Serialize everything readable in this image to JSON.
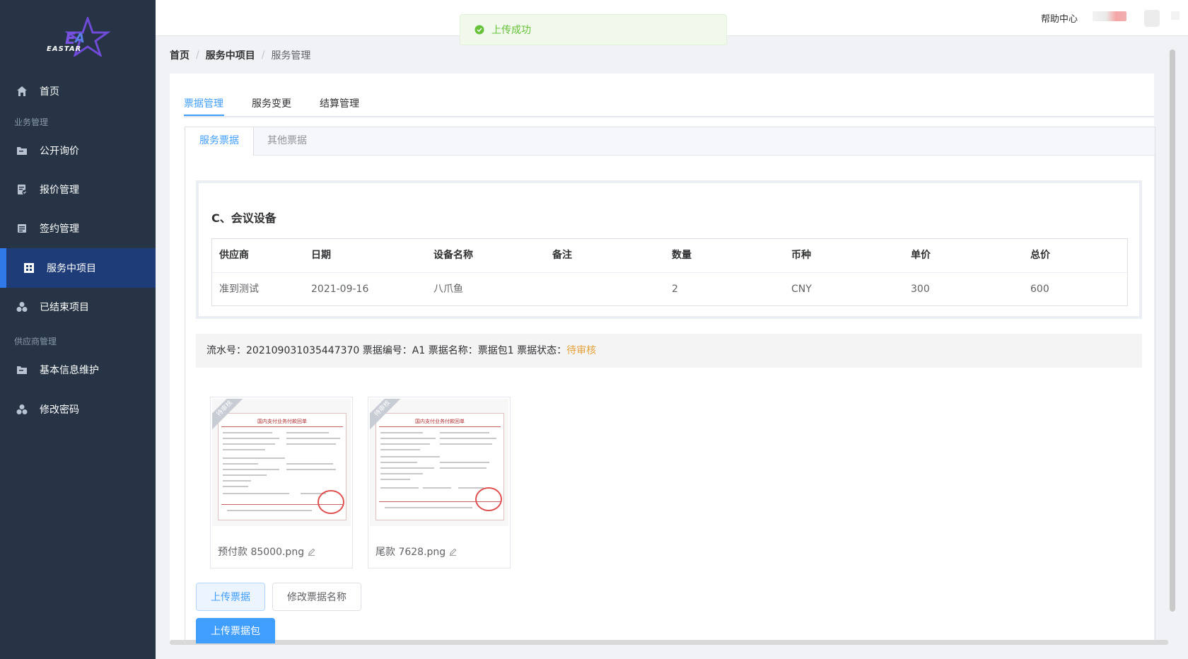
{
  "brand": {
    "logo_text": "EASTAR"
  },
  "sidebar": {
    "items": [
      {
        "label": "首页",
        "icon": "home-icon"
      },
      {
        "label": "公开询价",
        "icon": "folder-icon"
      },
      {
        "label": "报价管理",
        "icon": "doc-check-icon"
      },
      {
        "label": "签约管理",
        "icon": "contract-icon"
      },
      {
        "label": "服务中项目",
        "icon": "grid-icon"
      },
      {
        "label": "已结束项目",
        "icon": "cluster-icon"
      },
      {
        "label": "基本信息维护",
        "icon": "folder-icon"
      },
      {
        "label": "修改密码",
        "icon": "cluster-icon"
      }
    ],
    "groups": [
      "业务管理",
      "供应商管理"
    ],
    "active_index": 4
  },
  "header": {
    "help": "帮助中心"
  },
  "toast": {
    "text": "上传成功",
    "color": "#67c23a"
  },
  "breadcrumb": {
    "home": "首页",
    "parent": "服务中项目",
    "current": "服务管理"
  },
  "tabs": [
    "票据管理",
    "服务变更",
    "结算管理"
  ],
  "inner_tabs": [
    "服务票据",
    "其他票据"
  ],
  "equipment": {
    "title": "C、会议设备",
    "columns": [
      "供应商",
      "日期",
      "设备名称",
      "备注",
      "数量",
      "币种",
      "单价",
      "总价"
    ],
    "rows": [
      [
        "准到测试",
        "2021-09-16",
        "八爪鱼",
        "",
        "2",
        "CNY",
        "300",
        "600"
      ]
    ]
  },
  "ticket_info": {
    "serial_label": "流水号：",
    "serial": "202109031035447370",
    "number_label": "票据编号：",
    "number": "A1",
    "name_label": "票据名称：",
    "name": "票据包1",
    "status_label": "票据状态：",
    "status": "待审核",
    "status_color": "#e6a23c"
  },
  "files": [
    {
      "name": "预付款 85000.png",
      "badge": "待审核",
      "doc_title": "国内支付业务付款回单"
    },
    {
      "name": "尾款 7628.png",
      "badge": "待审核",
      "doc_title": "国内支付业务付款回单"
    }
  ],
  "buttons": {
    "upload": "上传票据",
    "rename": "修改票据名称",
    "upload_pkg": "上传票据包"
  },
  "colors": {
    "sidebar_bg": "#263445",
    "active_bg": "#1e3c78",
    "accent": "#409eff"
  }
}
